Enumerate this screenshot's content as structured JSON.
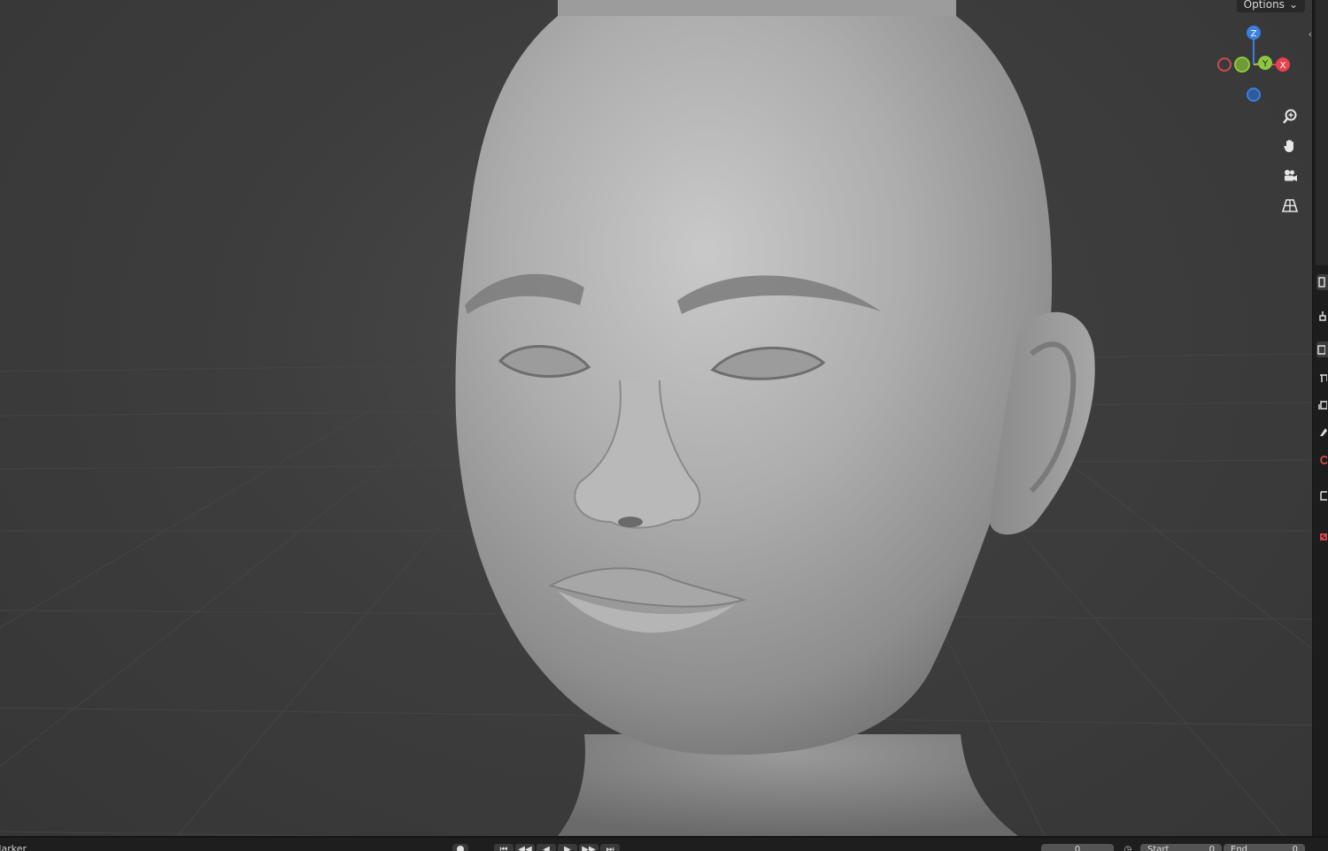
{
  "viewport": {
    "options_label": "Options",
    "gizmo": {
      "z_label": "Z",
      "y_label": "Y",
      "x_label": "X",
      "colors": {
        "x": "#e8414f",
        "y": "#8cc63f",
        "z": "#3b7fe0"
      }
    },
    "nav_buttons": [
      {
        "name": "zoom-icon"
      },
      {
        "name": "hand-pan-icon"
      },
      {
        "name": "camera-icon"
      },
      {
        "name": "perspective-grid-icon"
      }
    ]
  },
  "timeline": {
    "marker_label": "Marker",
    "current_frame": "0",
    "start_label": "Start",
    "start_value": "0",
    "end_label": "End",
    "end_value": "0",
    "playback_buttons": [
      "⏮",
      "◀◀",
      "◀",
      "▶",
      "▶▶",
      "⏭"
    ]
  }
}
